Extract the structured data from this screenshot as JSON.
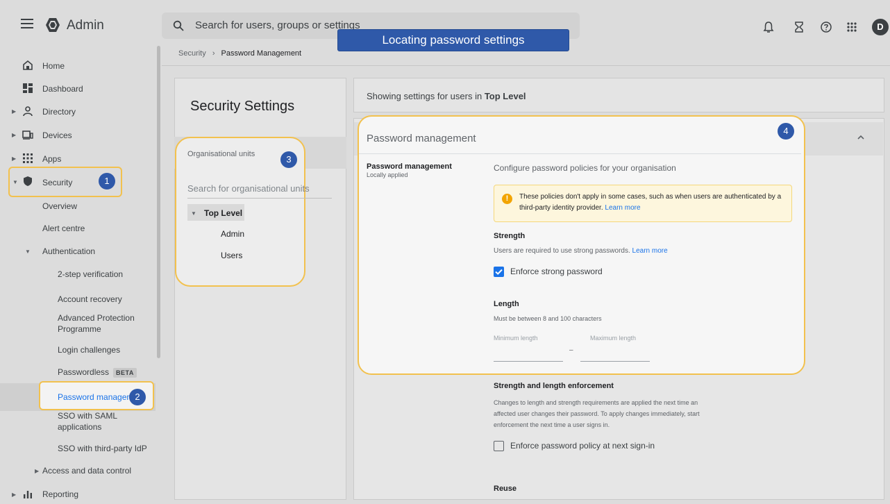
{
  "header": {
    "brand": "Admin",
    "search_placeholder": "Search for users, groups or settings",
    "banner": "Locating password settings",
    "avatar_letter": "D"
  },
  "breadcrumb": {
    "parent": "Security",
    "separator": "›",
    "current": "Password Management"
  },
  "sidebar": {
    "home": "Home",
    "dashboard": "Dashboard",
    "directory": "Directory",
    "devices": "Devices",
    "apps": "Apps",
    "security": "Security",
    "overview": "Overview",
    "alert_centre": "Alert centre",
    "authentication": "Authentication",
    "two_step": "2-step verification",
    "account_recovery": "Account recovery",
    "app_line1": "Advanced Protection",
    "app_line2": "Programme",
    "login_challenges": "Login challenges",
    "passwordless": "Passwordless",
    "beta": "BETA",
    "password_management": "Password managem",
    "saml_line1": "SSO with SAML",
    "saml_line2": "applications",
    "sso_third": "SSO with third-party IdP",
    "access_data": "Access and data control",
    "reporting": "Reporting"
  },
  "callouts": {
    "c1": "1",
    "c2": "2",
    "c3": "3",
    "c4": "4"
  },
  "left_panel": {
    "title": "Security Settings",
    "ou_label": "Organisational units",
    "ou_search": "Search for organisational units",
    "top_level": "Top Level",
    "children": [
      "Admin",
      "Users"
    ]
  },
  "right_panel": {
    "showing_prefix": "Showing settings for users in",
    "showing_scope": "Top Level",
    "section_title": "Password management",
    "pm_label": "Password management",
    "pm_sub": "Locally applied",
    "pm_desc": "Configure password policies for your organisation",
    "info_text": "These policies don't apply in some cases, such as when users are authenticated by a third-party identity provider.",
    "info_link": "Learn more",
    "strength_h": "Strength",
    "strength_desc": "Users are required to use strong passwords.",
    "strength_link": "Learn more",
    "enforce_strong": "Enforce strong password",
    "length_h": "Length",
    "length_desc": "Must be between 8 and 100 characters",
    "min_label": "Minimum length",
    "max_label": "Maximum length",
    "dash": "–",
    "enforcement_h": "Strength and length enforcement",
    "enforcement_l1": "Changes to length and strength requirements are applied the next time an",
    "enforcement_l2": "affected user changes their password. To apply changes immediately, start",
    "enforcement_l3": "enforcement the next time a user signs in.",
    "enforce_next": "Enforce password policy at next sign-in",
    "reuse_h": "Reuse"
  },
  "colors": {
    "accent": "#1a73e8",
    "highlight": "#f2c14e",
    "callout": "#2f59a9"
  }
}
